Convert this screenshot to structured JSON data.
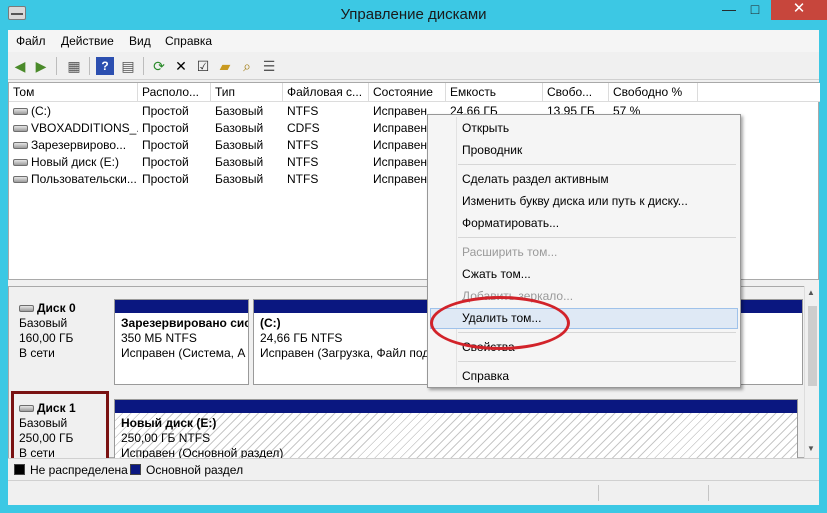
{
  "window": {
    "title": "Управление дисками",
    "controls": {
      "minimize": "—",
      "maximize": "□",
      "close": "✕"
    }
  },
  "menu": [
    "Файл",
    "Действие",
    "Вид",
    "Справка"
  ],
  "toolbar_icons": [
    "back-icon",
    "forward-icon",
    "console-icon",
    "help-icon",
    "properties-icon",
    "refresh-icon",
    "delete-icon",
    "check-icon",
    "open-folder-icon",
    "search-icon",
    "list-icon"
  ],
  "volumes": {
    "columns": [
      "Том",
      "Располо...",
      "Тип",
      "Файловая с...",
      "Состояние",
      "Емкость",
      "Свобо...",
      "Свободно %"
    ],
    "rows": [
      [
        "(C:)",
        "Простой",
        "Базовый",
        "NTFS",
        "Исправен",
        "24,66 ГБ",
        "13,95 ГБ",
        "57 %"
      ],
      [
        "VBOXADDITIONS_...",
        "Простой",
        "Базовый",
        "CDFS",
        "Исправен",
        "",
        "",
        ""
      ],
      [
        "Зарезервирово...",
        "Простой",
        "Базовый",
        "NTFS",
        "Исправен",
        "",
        "",
        ""
      ],
      [
        "Новый диск (E:)",
        "Простой",
        "Базовый",
        "NTFS",
        "Исправен",
        "",
        "",
        ""
      ],
      [
        "Пользовательски...",
        "Простой",
        "Базовый",
        "NTFS",
        "Исправен",
        "",
        "",
        ""
      ]
    ]
  },
  "disks": [
    {
      "name": "Диск 0",
      "type": "Базовый",
      "size": "160,00 ГБ",
      "status": "В сети",
      "partitions": [
        {
          "label": "Зарезервировано сис",
          "size": "350 МБ NTFS",
          "status": "Исправен (Система, А"
        },
        {
          "label": "(C:)",
          "size": "24,66 ГБ NTFS",
          "status": "Исправен (Загрузка, Файл подк"
        }
      ]
    },
    {
      "name": "Диск 1",
      "type": "Базовый",
      "size": "250,00 ГБ",
      "status": "В сети",
      "partitions": [
        {
          "label": "Новый диск  (E:)",
          "size": "250,00 ГБ NTFS",
          "status": "Исправен (Основной раздел)"
        }
      ]
    }
  ],
  "legend": [
    {
      "label": "Не распределена",
      "color": "#000000"
    },
    {
      "label": "Основной раздел",
      "color": "#0a1780"
    }
  ],
  "context_menu": {
    "items": [
      {
        "label": "Открыть",
        "enabled": true
      },
      {
        "label": "Проводник",
        "enabled": true
      },
      {
        "label": "Сделать раздел активным",
        "enabled": true
      },
      {
        "label": "Изменить букву диска или путь к диску...",
        "enabled": true
      },
      {
        "label": "Форматировать...",
        "enabled": true
      },
      {
        "label": "Расширить том...",
        "enabled": false
      },
      {
        "label": "Сжать том...",
        "enabled": true
      },
      {
        "label": "Добавить зеркало...",
        "enabled": false
      },
      {
        "label": "Удалить том...",
        "enabled": true,
        "highlighted": true
      },
      {
        "label": "Свойства",
        "enabled": true
      },
      {
        "label": "Справка",
        "enabled": true
      }
    ]
  },
  "annotation_colors": {
    "ellipse": "#d2232a",
    "disk_highlight": "#7a1212"
  }
}
